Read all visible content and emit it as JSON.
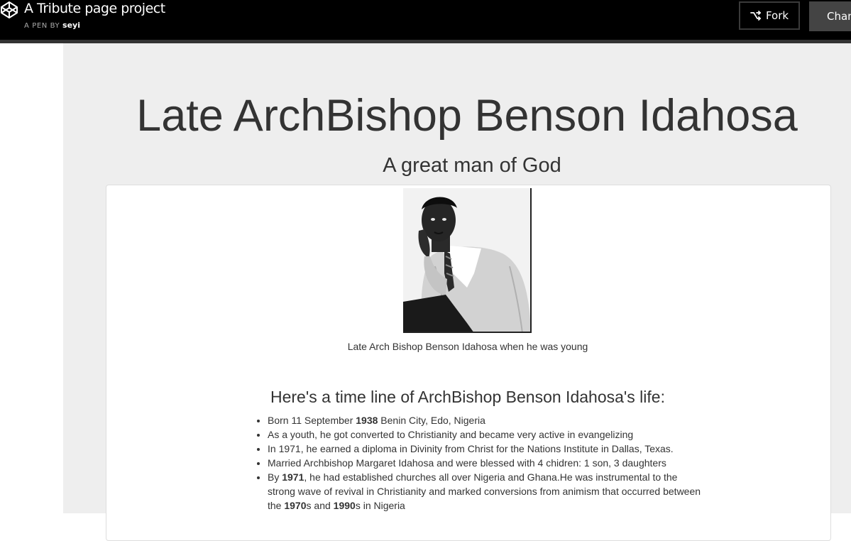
{
  "header": {
    "title": "A Tribute page project",
    "pen_by_prefix": "A PEN BY",
    "author": "seyi",
    "fork_label": "Fork",
    "change_label": "Change View"
  },
  "page": {
    "title": "Late ArchBishop Benson Idahosa",
    "subtitle": "A great man of God",
    "image_caption": "Late Arch Bishop Benson Idahosa when he was young",
    "timeline_heading": "Here's a time line of ArchBishop Benson Idahosa's life:",
    "timeline": [
      {
        "pre": "Born 11 September ",
        "bold": "1938",
        "post": " Benin City, Edo, Nigeria"
      },
      {
        "pre": "As a youth, he got converted to Christianity and became very active in evangelizing",
        "bold": "",
        "post": ""
      },
      {
        "pre": "In 1971, he earned a diploma in Divinity from Christ for the Nations Institute in Dallas, Texas.",
        "bold": "",
        "post": ""
      },
      {
        "pre": "Married Archbishop Margaret Idahosa and were blessed with 4 chidren: 1 son, 3 daughters",
        "bold": "",
        "post": ""
      },
      {
        "pre": "By ",
        "bold": "1971",
        "post": ", he had established churches all over Nigeria and Ghana.He was instrumental to the strong wave of revival in Christianity and marked conversions from animism that occurred between the ",
        "bold2": "1970",
        "post2": "s and ",
        "bold3": "1990",
        "post3": "s in Nigeria"
      }
    ]
  },
  "colors": {
    "header_bg": "#000000",
    "preview_bg": "#eeeeee",
    "card_bg": "#ffffff",
    "text": "#333333"
  },
  "icons": [
    "codepen-logo-icon",
    "fork-icon",
    "view-icon"
  ]
}
